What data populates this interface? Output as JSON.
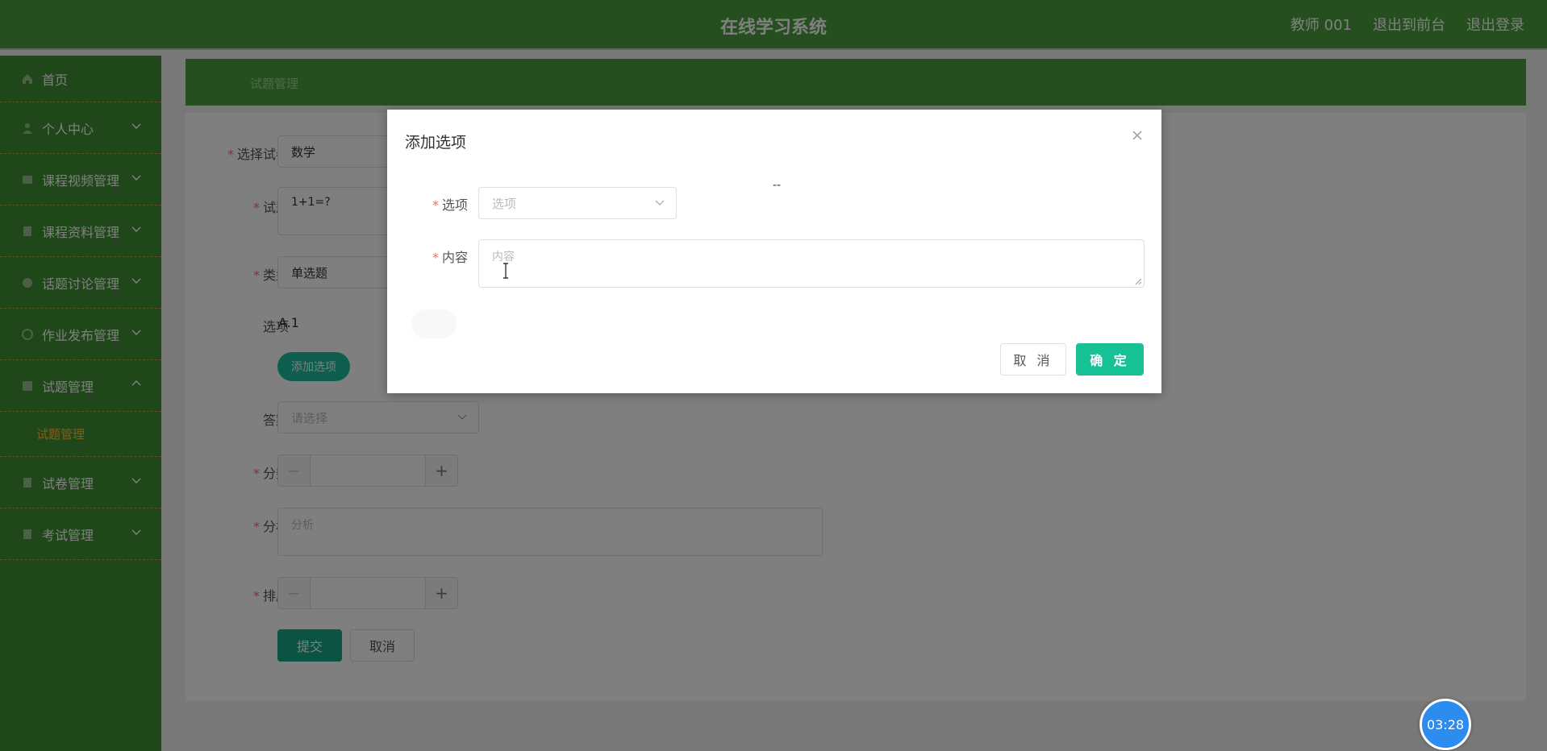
{
  "header": {
    "title": "在线学习系统",
    "user": "教师 001",
    "to_front": "退出到前台",
    "logout": "退出登录"
  },
  "sidebar": {
    "items": [
      {
        "label": "首页",
        "icon": "home-icon"
      },
      {
        "label": "个人中心",
        "icon": "user-icon"
      },
      {
        "label": "课程视频管理",
        "icon": "video-icon"
      },
      {
        "label": "课程资料管理",
        "icon": "document-icon"
      },
      {
        "label": "话题讨论管理",
        "icon": "chat-icon"
      },
      {
        "label": "作业发布管理",
        "icon": "task-icon"
      },
      {
        "label": "试题管理",
        "icon": "question-icon",
        "expanded": true
      },
      {
        "label": "试卷管理",
        "icon": "paper-icon"
      },
      {
        "label": "考试管理",
        "icon": "exam-icon"
      }
    ],
    "sub_item": "试题管理"
  },
  "breadcrumb": "试题管理",
  "form": {
    "paper_label": "选择试卷",
    "paper_value": "数学",
    "question_label": "试题",
    "question_value": "1+1=?",
    "type_label": "类型",
    "type_value": "单选题",
    "options_label": "选项",
    "options_value": "A.1",
    "add_option": "添加选项",
    "answer_label": "答案",
    "answer_placeholder": "请选择",
    "score_label": "分数",
    "analysis_label": "分析",
    "analysis_placeholder": "分析",
    "order_label": "排序",
    "submit": "提交",
    "cancel": "取消",
    "minus": "−",
    "plus": "+"
  },
  "dialog": {
    "title": "添加选项",
    "option_label": "选项",
    "option_placeholder": "选项",
    "content_label": "内容",
    "content_placeholder": "内容",
    "dash": "--",
    "cancel": "取 消",
    "confirm": "确 定"
  },
  "timer": "03:28",
  "colors": {
    "header_green": "#4d9e3f",
    "sidebar_green": "#3f8f34",
    "accent_teal": "#16c195",
    "required_red": "#f56c6c",
    "active_sub": "#f5c242",
    "timer_blue": "#2d8cf0"
  }
}
